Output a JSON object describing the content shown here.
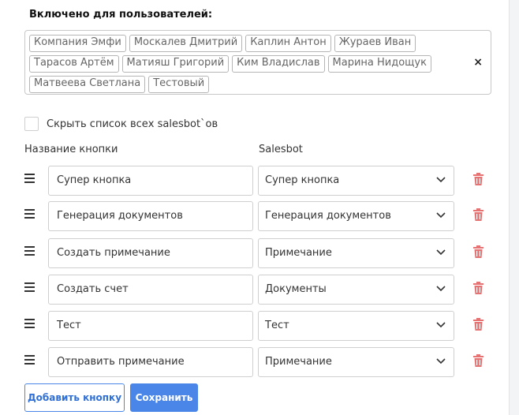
{
  "enabled_for_users": {
    "title": "Включено для пользователей:",
    "users": [
      "Компания Эмфи",
      "Москалев Дмитрий",
      "Каплин Антон",
      "Жураев Иван",
      "Тарасов Артём",
      "Матияш Григорий",
      "Ким Владислав",
      "Марина Нидощук",
      "Матвеева Светлана",
      "Тестовый"
    ],
    "clear_symbol": "×"
  },
  "hide_list": {
    "label": "Скрыть список всех salesbot`ов",
    "checked": false
  },
  "columns": {
    "button_name": "Название кнопки",
    "salesbot": "Salesbot"
  },
  "rows": [
    {
      "button_name": "Супер кнопка",
      "salesbot": "Супер кнопка"
    },
    {
      "button_name": "Генерация документов",
      "salesbot": "Генерация документов"
    },
    {
      "button_name": "Создать примечание",
      "salesbot": "Примечание"
    },
    {
      "button_name": "Создать счет",
      "salesbot": "Документы"
    },
    {
      "button_name": "Тест",
      "salesbot": "Тест"
    },
    {
      "button_name": "Отправить примечание",
      "salesbot": "Примечание"
    }
  ],
  "icons": {
    "drag": "drag-handle-icon",
    "chevron": "chevron-down-icon",
    "delete": "trash-icon"
  },
  "actions": {
    "add_button": "Добавить кнопку",
    "save": "Сохранить"
  },
  "colors": {
    "accent": "#4a86e8",
    "delete": "#e57373"
  }
}
